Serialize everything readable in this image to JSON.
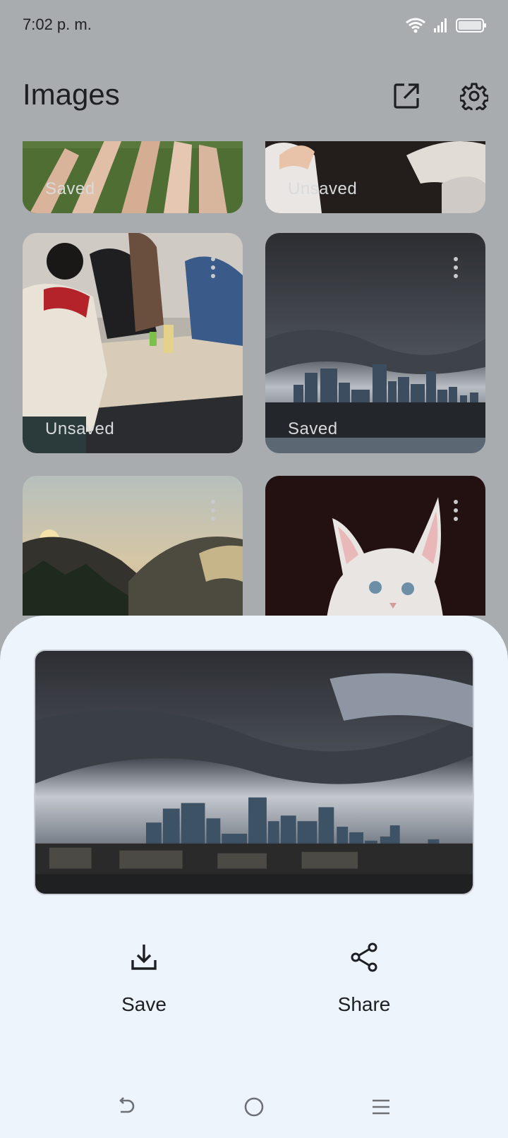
{
  "status": {
    "time": "7:02 p. m."
  },
  "app_bar": {
    "title": "Images",
    "icons": [
      "open-in-new-icon",
      "settings-gear-icon"
    ]
  },
  "grid": {
    "tiles": [
      {
        "label": "Saved",
        "scene": "hands-on-grass",
        "has_menu": false
      },
      {
        "label": "Unsaved",
        "scene": "hands-dark",
        "has_menu": false
      },
      {
        "label": "Unsaved",
        "scene": "people-at-table",
        "has_menu": true
      },
      {
        "label": "Saved",
        "scene": "city-storm",
        "has_menu": true
      },
      {
        "label": "",
        "scene": "mountain-sunset",
        "has_menu": true
      },
      {
        "label": "",
        "scene": "white-kitten",
        "has_menu": true
      }
    ]
  },
  "sheet": {
    "preview_scene": "city-storm",
    "actions": [
      {
        "label": "Save",
        "icon": "download-icon"
      },
      {
        "label": "Share",
        "icon": "share-icon"
      }
    ]
  },
  "nav": {
    "icons": [
      "back-icon",
      "home-icon",
      "menu-icon"
    ]
  }
}
